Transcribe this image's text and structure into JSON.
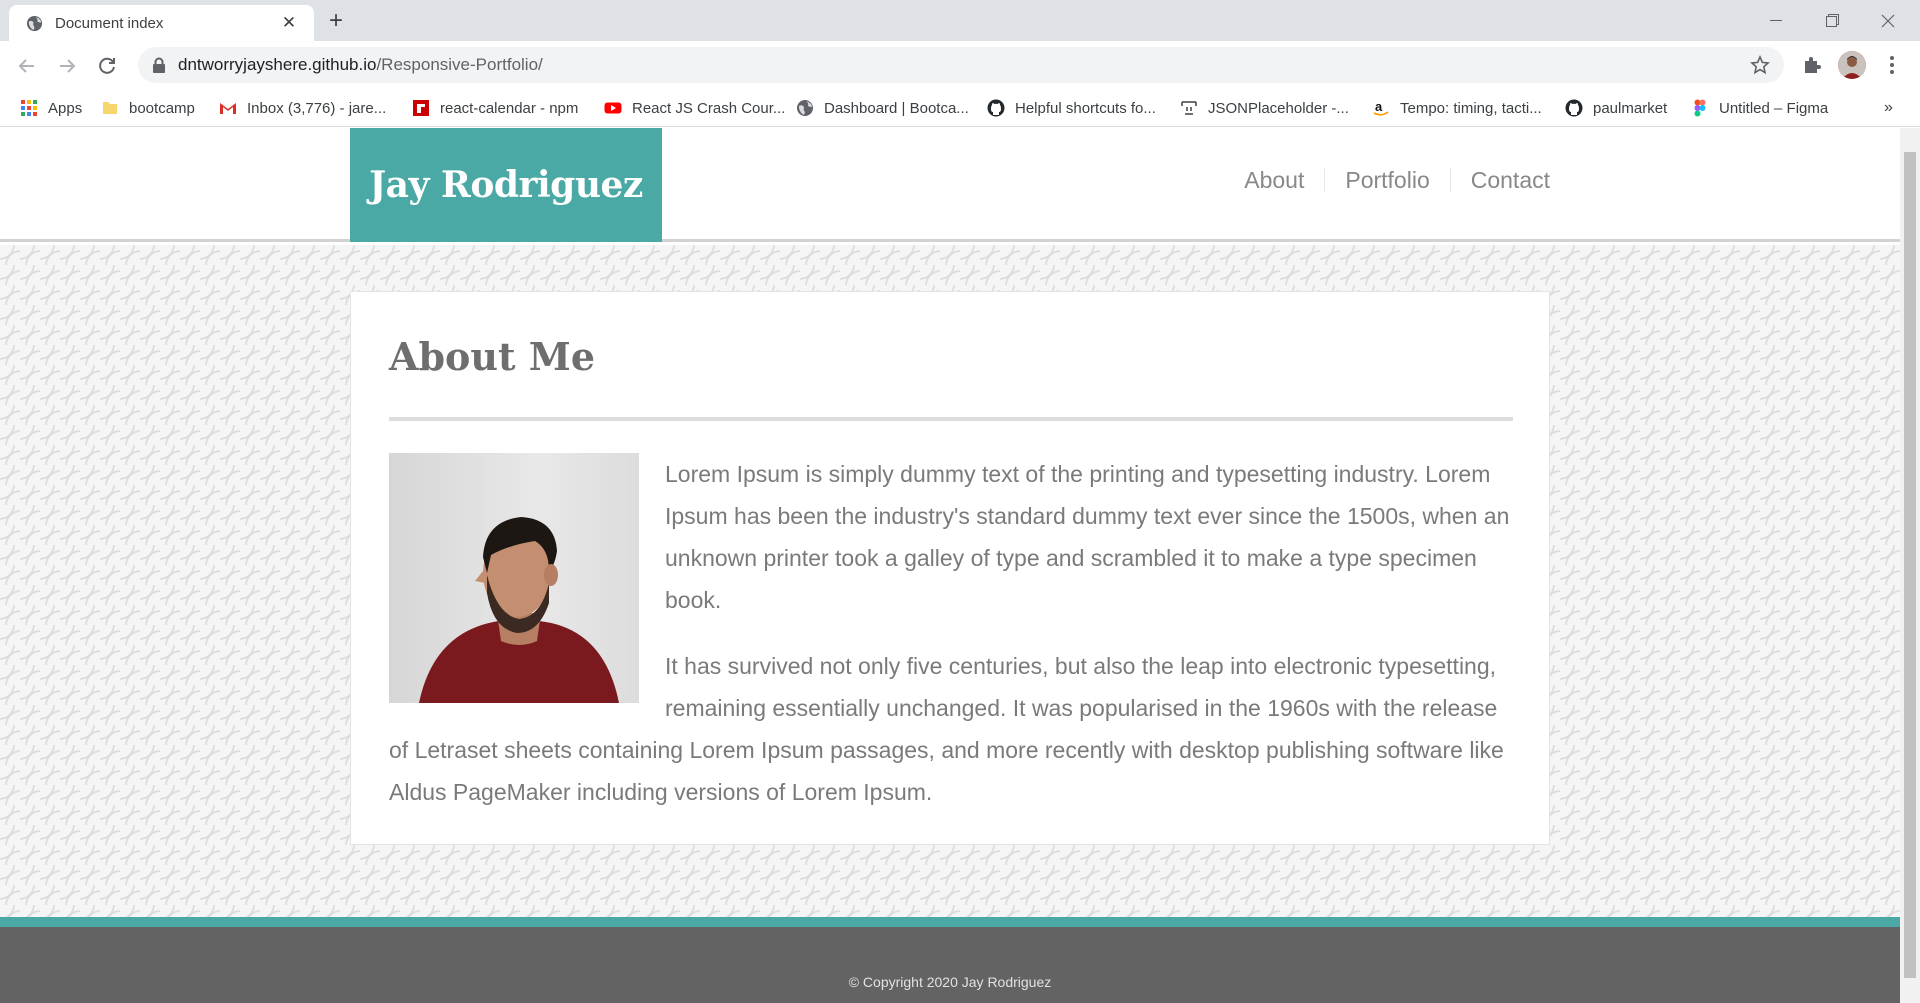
{
  "browser": {
    "tab_title": "Document index",
    "url_host": "dntworryjayshere.github.io",
    "url_path": "/Responsive-Portfolio/",
    "bookmarks": [
      {
        "label": "Apps",
        "icon": "apps-grid-icon"
      },
      {
        "label": "bootcamp",
        "icon": "folder-icon"
      },
      {
        "label": "Inbox (3,776) - jare...",
        "icon": "gmail-icon"
      },
      {
        "label": "react-calendar - npm",
        "icon": "npm-icon"
      },
      {
        "label": "React JS Crash Cour...",
        "icon": "youtube-icon"
      },
      {
        "label": "Dashboard | Bootca...",
        "icon": "globe-icon"
      },
      {
        "label": "Helpful shortcuts fo...",
        "icon": "github-icon"
      },
      {
        "label": "JSONPlaceholder -...",
        "icon": "json-icon"
      },
      {
        "label": "Tempo: timing, tacti...",
        "icon": "amazon-icon"
      },
      {
        "label": "paulmarket",
        "icon": "github-icon"
      },
      {
        "label": "Untitled – Figma",
        "icon": "figma-icon"
      }
    ],
    "more_bookmarks": "»"
  },
  "site": {
    "logo": "Jay Rodriguez",
    "nav": [
      "About",
      "Portfolio",
      "Contact"
    ],
    "accent_color": "#4aa9a5"
  },
  "about": {
    "heading": "About Me",
    "paragraphs": [
      "Lorem Ipsum is simply dummy text of the printing and typesetting industry. Lorem Ipsum has been the industry's standard dummy text ever since the 1500s, when an unknown printer took a galley of type and scrambled it to make a type specimen book.",
      "It has survived not only five centuries, but also the leap into electronic typesetting, remaining essentially unchanged. It was popularised in the 1960s with the release of Letraset sheets containing Lorem Ipsum passages, and more recently with desktop publishing software like Aldus PageMaker including versions of Lorem Ipsum."
    ]
  },
  "footer": {
    "copyright": "© Copyright 2020 Jay Rodriguez"
  }
}
